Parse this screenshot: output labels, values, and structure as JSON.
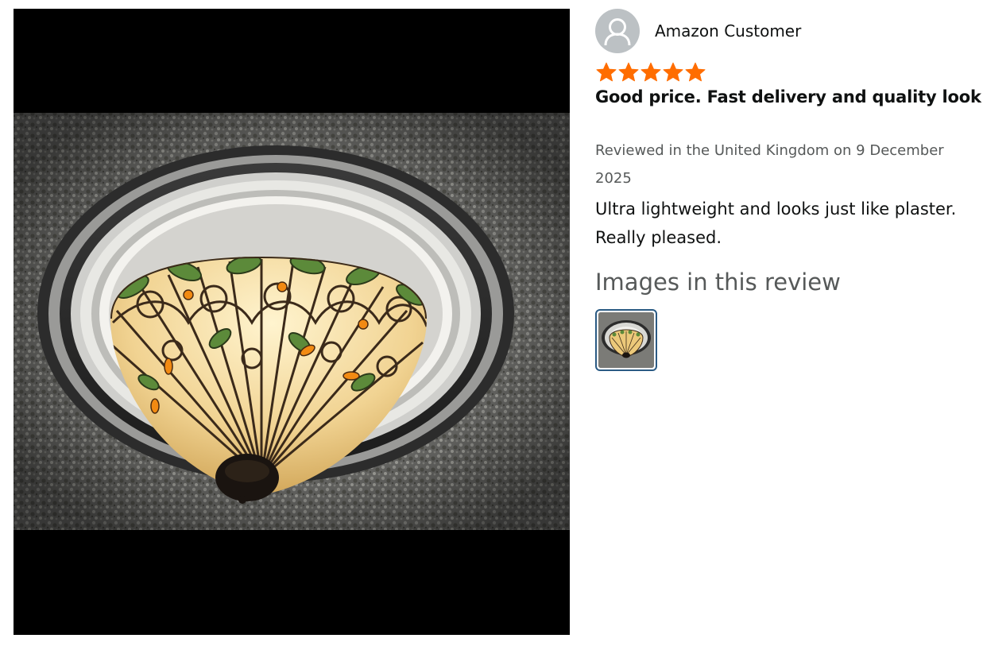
{
  "review": {
    "reviewer_name": "Amazon Customer",
    "rating": 5,
    "rating_max": 5,
    "title": "Good price. Fast delivery and quality look",
    "meta": "Reviewed in the United Kingdom on 9 December 2025",
    "body": "Ultra lightweight and looks just like plaster. Really pleased."
  },
  "images_section": {
    "heading": "Images in this review"
  },
  "colors": {
    "star": "#ff6d00",
    "thumb_border": "#2b5b84",
    "avatar_bg": "#bcc1c4",
    "meta_text": "#565959"
  },
  "icons": {
    "avatar": "person-icon",
    "star": "star-icon"
  }
}
